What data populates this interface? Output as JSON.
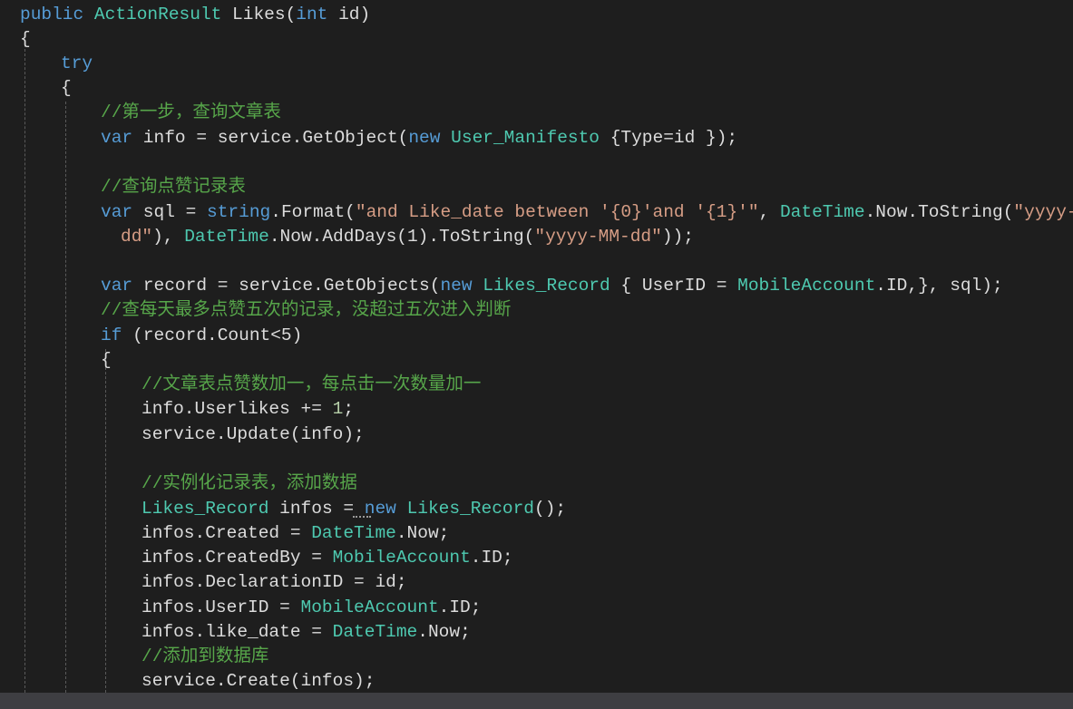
{
  "code": {
    "lines": [
      {
        "tokens": [
          {
            "t": "public ",
            "c": "kw"
          },
          {
            "t": "ActionResult",
            "c": "ty"
          },
          {
            "t": " Likes(",
            "c": "pl"
          },
          {
            "t": "int",
            "c": "kw"
          },
          {
            "t": " id)",
            "c": "pl"
          }
        ]
      },
      {
        "tokens": [
          {
            "t": "{",
            "c": "pl"
          }
        ]
      },
      {
        "tokens": [
          {
            "t": "try",
            "c": "kw"
          }
        ]
      },
      {
        "tokens": [
          {
            "t": "{",
            "c": "pl"
          }
        ]
      },
      {
        "tokens": [
          {
            "t": "//第一步，查询文章表",
            "c": "cm"
          }
        ]
      },
      {
        "tokens": [
          {
            "t": "var",
            "c": "kw"
          },
          {
            "t": " info = service.GetObject(",
            "c": "pl"
          },
          {
            "t": "new",
            "c": "kw"
          },
          {
            "t": " ",
            "c": "pl"
          },
          {
            "t": "User_Manifesto",
            "c": "ty"
          },
          {
            "t": " {Type=id });",
            "c": "pl"
          }
        ]
      },
      {
        "tokens": []
      },
      {
        "tokens": [
          {
            "t": "//查询点赞记录表",
            "c": "cm"
          }
        ]
      },
      {
        "tokens": [
          {
            "t": "var",
            "c": "kw"
          },
          {
            "t": " sql = ",
            "c": "pl"
          },
          {
            "t": "string",
            "c": "kw"
          },
          {
            "t": ".Format(",
            "c": "pl"
          },
          {
            "t": "\"and Like_date between '{0}'and '{1}'\"",
            "c": "str"
          },
          {
            "t": ", ",
            "c": "pl"
          },
          {
            "t": "DateTime",
            "c": "ty"
          },
          {
            "t": ".Now.ToString(",
            "c": "pl"
          },
          {
            "t": "\"yyyy-MM-",
            "c": "str"
          }
        ]
      },
      {
        "tokens": [
          {
            "t": "dd\"",
            "c": "str"
          },
          {
            "t": "), ",
            "c": "pl"
          },
          {
            "t": "DateTime",
            "c": "ty"
          },
          {
            "t": ".Now.AddDays(1).ToString(",
            "c": "pl"
          },
          {
            "t": "\"yyyy-MM-dd\"",
            "c": "str"
          },
          {
            "t": "));",
            "c": "pl"
          }
        ]
      },
      {
        "tokens": []
      },
      {
        "tokens": [
          {
            "t": "var",
            "c": "kw"
          },
          {
            "t": " record = service.GetObjects(",
            "c": "pl"
          },
          {
            "t": "new",
            "c": "kw"
          },
          {
            "t": " ",
            "c": "pl"
          },
          {
            "t": "Likes_Record",
            "c": "ty"
          },
          {
            "t": " { UserID = ",
            "c": "pl"
          },
          {
            "t": "MobileAccount",
            "c": "ty"
          },
          {
            "t": ".ID,}, sql);",
            "c": "pl"
          }
        ]
      },
      {
        "tokens": [
          {
            "t": "//查每天最多点赞五次的记录，没超过五次进入判断",
            "c": "cm"
          }
        ]
      },
      {
        "tokens": [
          {
            "t": "if",
            "c": "kw"
          },
          {
            "t": " (record.Count<5)",
            "c": "pl"
          }
        ]
      },
      {
        "tokens": [
          {
            "t": "{",
            "c": "pl"
          }
        ]
      },
      {
        "tokens": [
          {
            "t": "//文章表点赞数加一，每点击一次数量加一",
            "c": "cm"
          }
        ]
      },
      {
        "tokens": [
          {
            "t": "info.Userlikes += ",
            "c": "pl"
          },
          {
            "t": "1",
            "c": "num"
          },
          {
            "t": ";",
            "c": "pl"
          }
        ]
      },
      {
        "tokens": [
          {
            "t": "service.Update(info);",
            "c": "pl"
          }
        ]
      },
      {
        "tokens": []
      },
      {
        "tokens": [
          {
            "t": "//实例化记录表，添加数据",
            "c": "cm"
          }
        ]
      },
      {
        "tokens": [
          {
            "t": "Likes_Record",
            "c": "ty"
          },
          {
            "t": " infos = ",
            "c": "pl"
          },
          {
            "t": "new",
            "c": "kw"
          },
          {
            "t": " ",
            "c": "pl"
          },
          {
            "t": "Likes_Record",
            "c": "ty"
          },
          {
            "t": "();",
            "c": "pl"
          }
        ]
      },
      {
        "tokens": [
          {
            "t": "infos.Created = ",
            "c": "pl"
          },
          {
            "t": "DateTime",
            "c": "ty"
          },
          {
            "t": ".Now;",
            "c": "pl"
          }
        ]
      },
      {
        "tokens": [
          {
            "t": "infos.CreatedBy = ",
            "c": "pl"
          },
          {
            "t": "MobileAccount",
            "c": "ty"
          },
          {
            "t": ".ID;",
            "c": "pl"
          }
        ]
      },
      {
        "tokens": [
          {
            "t": "infos.DeclarationID = id;",
            "c": "pl"
          }
        ]
      },
      {
        "tokens": [
          {
            "t": "infos.UserID = ",
            "c": "pl"
          },
          {
            "t": "MobileAccount",
            "c": "ty"
          },
          {
            "t": ".ID;",
            "c": "pl"
          }
        ]
      },
      {
        "tokens": [
          {
            "t": "infos.like_date = ",
            "c": "pl"
          },
          {
            "t": "DateTime",
            "c": "ty"
          },
          {
            "t": ".Now;",
            "c": "pl"
          }
        ]
      },
      {
        "tokens": [
          {
            "t": "//添加到数据库",
            "c": "cm"
          }
        ]
      },
      {
        "tokens": [
          {
            "t": "service.Create(infos);",
            "c": "pl"
          }
        ]
      }
    ]
  },
  "colors": {
    "background": "#1e1e1e",
    "keyword": "#569cd6",
    "type": "#4ec9b0",
    "string": "#d69d85",
    "comment": "#57a64a",
    "plain": "#dcdcdc",
    "number": "#b5cea8",
    "scrollbar": "#3e3e42"
  }
}
